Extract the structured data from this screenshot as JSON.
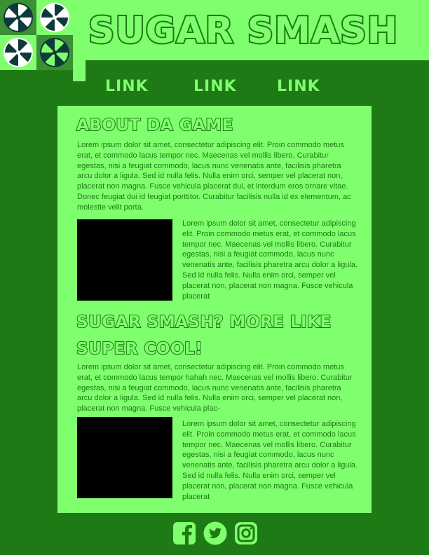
{
  "header": {
    "title": "SUGAR SMASH",
    "logo_icon": "candy-swirl-icon",
    "colors": {
      "light": "#80ff6e",
      "dark": "#1e7a14",
      "tile_dark": "#3b8f34",
      "candy": "#0d3b3b"
    }
  },
  "nav": {
    "links": [
      {
        "label": "LINK"
      },
      {
        "label": "LINK"
      },
      {
        "label": "LINK"
      }
    ]
  },
  "main": {
    "section1": {
      "heading": "ABOUT DA GAME",
      "intro": "Lorem ipsum dolor sit amet, consectetur adipiscing elit. Proin commodo metus erat, et commodo lacus tempor nec. Maecenas vel mollis libero. Curabitur egestas, nisi a feugiat commodo, lacus nunc venenatis ante, facilisis pharetra arcu dolor a ligula. Sed id nulla felis. Nulla enim orci, semper vel placerat non, placerat non magna. Fusce vehicula placerat dui, et interdum eros ornare vitae. Donec feugiat dui id feugiat porttitor. Curabitur facilisis nulla id ex elementum, ac molestie velit porta.",
      "side_text": "Lorem ipsum dolor sit amet, consectetur adipiscing elit. Proin commodo metus erat, et commodo lacus tempor nec. Maecenas vel mollis libero. Curabitur egestas, nisi a feugiat commodo, lacus nunc venenatis ante, facilisis pharetra arcu dolor a ligula. Sed id nulla felis. Nulla enim orci, semper vel placerat non, placerat non magna. Fusce vehicula placerat"
    },
    "section2": {
      "heading_line1": "SUGAR SMASH? MORE LIKE",
      "heading_line2": "SUPER COOL!",
      "intro": "Lorem ipsum dolor sit amet, consectetur adipiscing elit. Proin commodo metus erat, et commodo lacus tempor hahah nec. Maecenas vel mollis libero. Curabitur egestas, nisi a feugiat commodo, lacus nunc venenatis ante, facilisis pharetra arcu dolor a ligula. Sed id nulla felis. Nulla enim orci, semper vel placerat non, placerat non magna. Fusce vehicula plac-",
      "side_text": "Lorem ipsum dolor sit amet, consectetur adipiscing elit. Proin commodo metus erat, et commodo lacus tempor nec. Maecenas vel mollis libero. Curabitur egestas, nisi a feugiat commodo, lacus nunc venenatis ante, facilisis pharetra arcu dolor a ligula. Sed id nulla felis. Nulla enim orci, semper vel placerat non, placerat non magna. Fusce vehicula placerat"
    }
  },
  "footer": {
    "icons": [
      "facebook-icon",
      "twitter-icon",
      "instagram-icon"
    ]
  }
}
